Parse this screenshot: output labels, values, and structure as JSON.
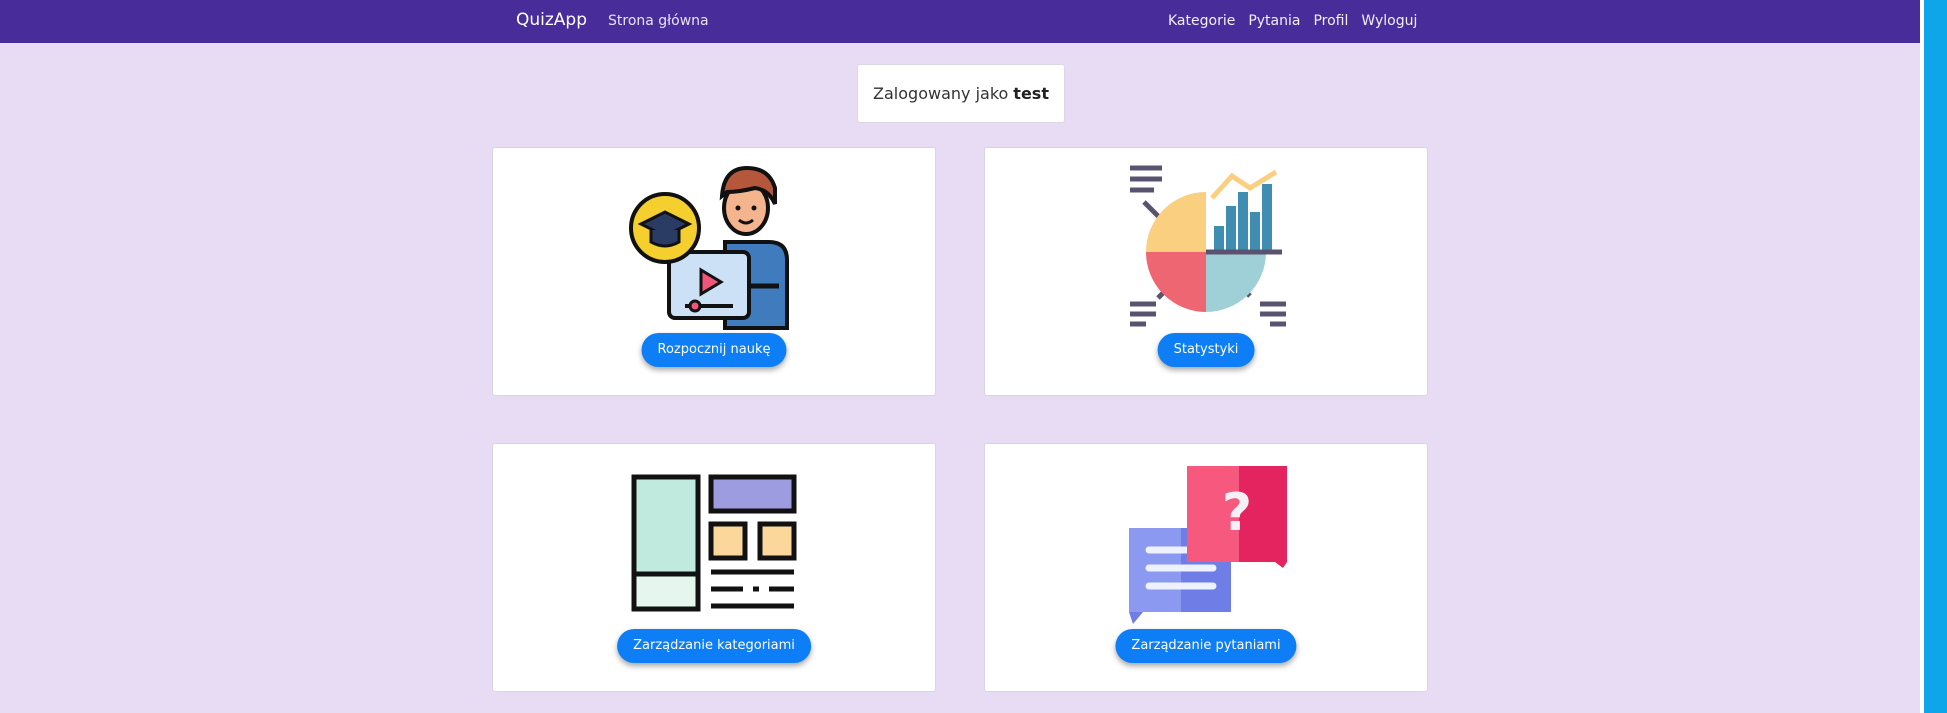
{
  "navbar": {
    "brand": "QuizApp",
    "home": "Strona główna",
    "links": [
      "Kategorie",
      "Pytania",
      "Profil",
      "Wyloguj"
    ],
    "color": "#482c9a"
  },
  "login": {
    "prefix": "Zalogowany jako",
    "username": "test"
  },
  "cards": [
    {
      "button": "Rozpocznij naukę",
      "icon": "teacher-online-icon"
    },
    {
      "button": "Statystyki",
      "icon": "statistics-chart-icon"
    },
    {
      "button": "Zarządzanie kategoriami",
      "icon": "layout-categories-icon"
    },
    {
      "button": "Zarządzanie pytaniami",
      "icon": "question-chat-icon"
    }
  ],
  "colors": {
    "background": "#e8dcf5",
    "button": "#0d7ef5"
  }
}
